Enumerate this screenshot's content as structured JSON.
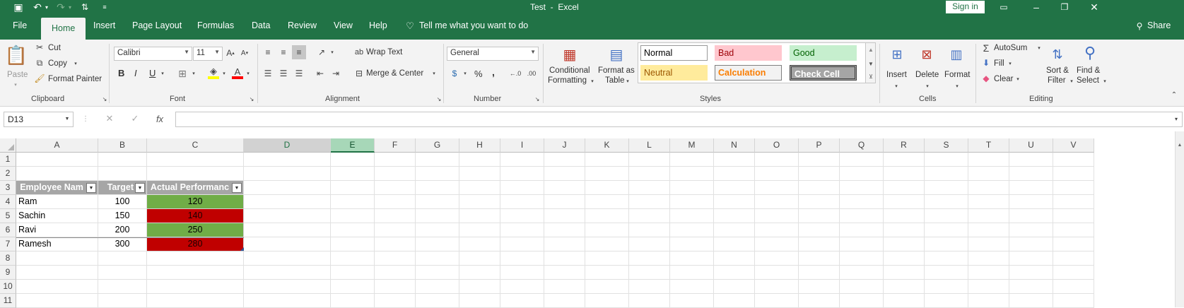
{
  "window": {
    "title": "Test  -  Excel",
    "sign_in": "Sign in"
  },
  "tabs": [
    "File",
    "Home",
    "Insert",
    "Page Layout",
    "Formulas",
    "Data",
    "Review",
    "View",
    "Help"
  ],
  "tell_me": "Tell me what you want to do",
  "share": "Share",
  "clipboard": {
    "paste": "Paste",
    "cut": "Cut",
    "copy": "Copy",
    "format_painter": "Format Painter",
    "label": "Clipboard"
  },
  "font": {
    "name": "Calibri",
    "size": "11",
    "label": "Font",
    "bold": "B",
    "italic": "I",
    "underline": "U"
  },
  "alignment": {
    "wrap_text": "Wrap Text",
    "merge_center": "Merge & Center",
    "label": "Alignment"
  },
  "number": {
    "format": "General",
    "percent": "%",
    "comma": ",",
    "label": "Number"
  },
  "styles": {
    "conditional_1": "Conditional",
    "conditional_2": "Formatting",
    "format_table_1": "Format as",
    "format_table_2": "Table",
    "normal": "Normal",
    "bad": "Bad",
    "good": "Good",
    "neutral": "Neutral",
    "calculation": "Calculation",
    "check_cell": "Check Cell",
    "label": "Styles"
  },
  "cells": {
    "insert": "Insert",
    "delete": "Delete",
    "format": "Format",
    "label": "Cells"
  },
  "editing": {
    "autosum": "AutoSum",
    "fill": "Fill",
    "clear": "Clear",
    "sort_1": "Sort &",
    "sort_2": "Filter",
    "find_1": "Find &",
    "find_2": "Select",
    "label": "Editing"
  },
  "formula_bar": {
    "name_box": "D13",
    "fx": "fx",
    "cancel": "✕",
    "enter": "✓",
    "content": ""
  },
  "columns": [
    "A",
    "B",
    "C",
    "D",
    "E",
    "F",
    "G",
    "H",
    "I",
    "J",
    "K",
    "L",
    "M",
    "N",
    "O",
    "P",
    "Q",
    "R",
    "S",
    "T",
    "U",
    "V"
  ],
  "rows": [
    "1",
    "2",
    "3",
    "4",
    "5",
    "6",
    "7",
    "8",
    "9",
    "10",
    "11"
  ],
  "table": {
    "headers": [
      "Employee Nam",
      "Target",
      "Actual Performanc"
    ],
    "data": [
      {
        "name": "Ram",
        "target": "100",
        "actual": "120",
        "status": "green"
      },
      {
        "name": "Sachin",
        "target": "150",
        "actual": "140",
        "status": "red"
      },
      {
        "name": "Ravi",
        "target": "200",
        "actual": "250",
        "status": "green"
      },
      {
        "name": "Ramesh",
        "target": "300",
        "actual": "280",
        "status": "red"
      }
    ]
  },
  "colors": {
    "excel_green": "#217346",
    "table_header": "#a6a6a6",
    "above_target": "#70ad47",
    "below_target": "#c00000"
  }
}
